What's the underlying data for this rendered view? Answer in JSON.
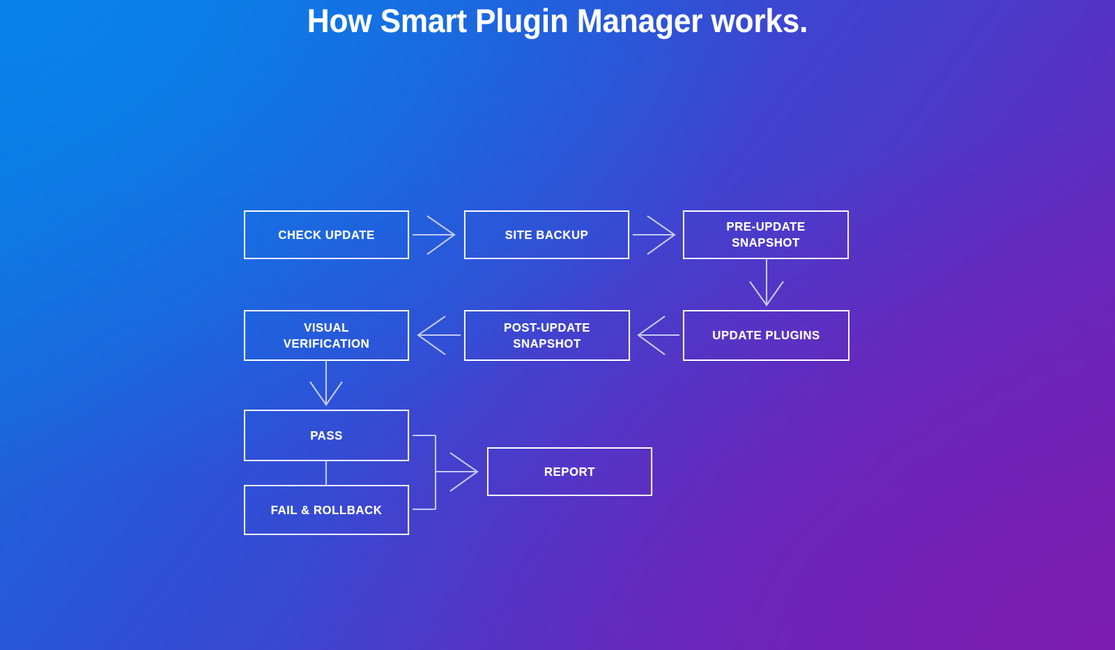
{
  "page": {
    "title": "How Smart Plugin Manager works.",
    "background": {
      "top_left_color": "#0B7AE0",
      "top_right_color": "#4040CC",
      "bottom_left_color": "#3355D5",
      "bottom_right_color": "#7020B0"
    },
    "box_border_color": "#FFFFFF",
    "box_text_color": "#FFFFFF",
    "arrow_color": "#C5CBF2"
  },
  "diagram": {
    "nodes": [
      {
        "id": "check-update",
        "label": "Check Update",
        "row": 1
      },
      {
        "id": "site-backup",
        "label": "Site Backup",
        "row": 1
      },
      {
        "id": "pre-update-snapshot",
        "label": "Pre-Update\nSnapshot",
        "row": 1
      },
      {
        "id": "visual-verification",
        "label": "Visual\nVerification",
        "row": 2
      },
      {
        "id": "post-update-snapshot",
        "label": "Post-Update\nSnapshot",
        "row": 2
      },
      {
        "id": "update-plugins",
        "label": "Update Plugins",
        "row": 2
      },
      {
        "id": "pass",
        "label": "Pass",
        "row": 3
      },
      {
        "id": "fail-rollback",
        "label": "Fail & Rollback",
        "row": 3
      },
      {
        "id": "report",
        "label": "Report",
        "row": 3
      }
    ],
    "edges": [
      {
        "from": "check-update",
        "to": "site-backup",
        "direction": "right"
      },
      {
        "from": "site-backup",
        "to": "pre-update-snapshot",
        "direction": "right"
      },
      {
        "from": "pre-update-snapshot",
        "to": "update-plugins",
        "direction": "down"
      },
      {
        "from": "update-plugins",
        "to": "post-update-snapshot",
        "direction": "left"
      },
      {
        "from": "post-update-snapshot",
        "to": "visual-verification",
        "direction": "left"
      },
      {
        "from": "visual-verification",
        "to": "pass",
        "direction": "down"
      },
      {
        "from": "pass",
        "to": "fail-rollback",
        "direction": "down"
      },
      {
        "from": "pass",
        "to": "report",
        "direction": "right"
      },
      {
        "from": "fail-rollback",
        "to": "report",
        "direction": "right"
      }
    ]
  }
}
